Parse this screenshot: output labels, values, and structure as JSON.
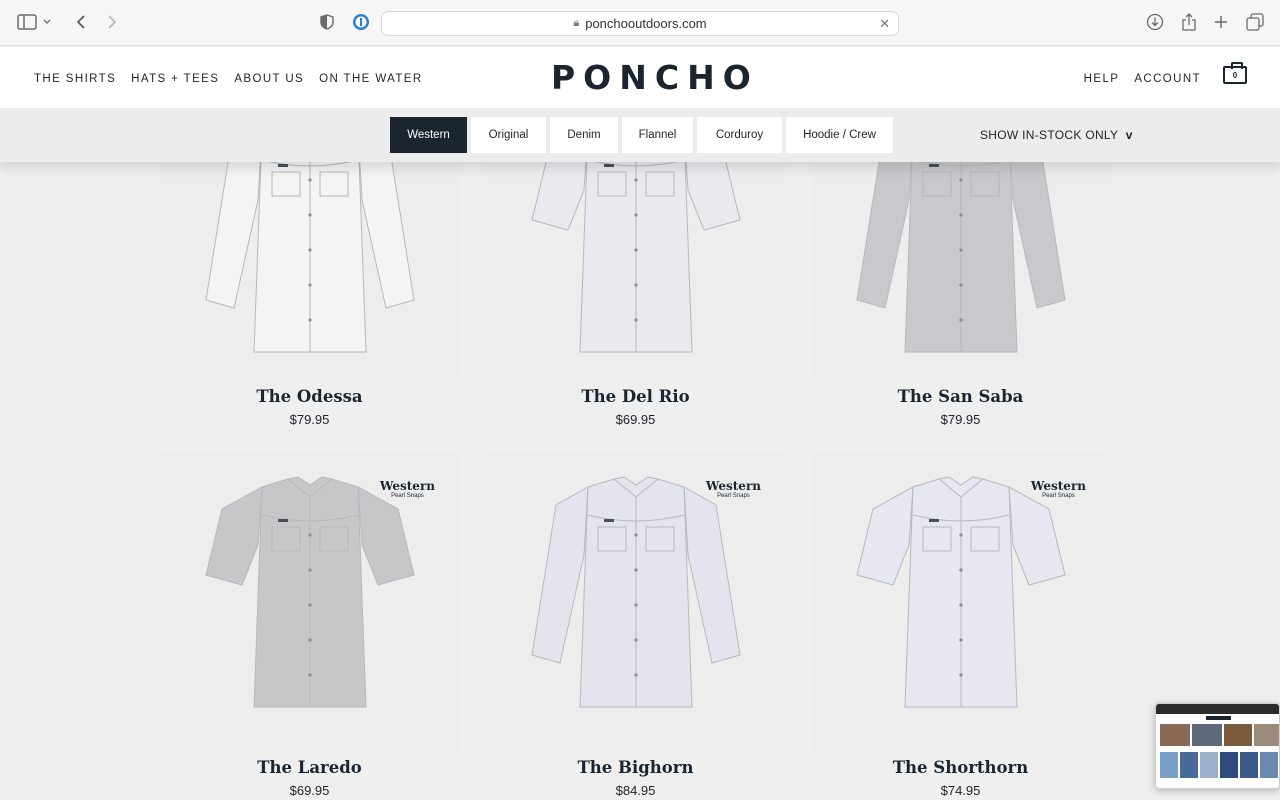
{
  "browser": {
    "url": "ponchooutdoors.com",
    "icons": [
      "sidebar-icon",
      "chevron-down-icon",
      "back-icon",
      "forward-icon",
      "shield-icon",
      "password-manager-icon",
      "clear-icon",
      "download-icon",
      "share-icon",
      "new-tab-icon",
      "tabs-overview-icon"
    ]
  },
  "header": {
    "logo": "PONCHO",
    "nav_left": [
      "THE SHIRTS",
      "HATS + TEES",
      "ABOUT US",
      "ON THE WATER"
    ],
    "nav_right": [
      "HELP",
      "ACCOUNT"
    ],
    "cart_count": "0"
  },
  "filters": {
    "tabs": [
      "Western",
      "Original",
      "Denim",
      "Flannel",
      "Corduroy",
      "Hoodie / Crew"
    ],
    "active_tab": "Western",
    "instock_label": "SHOW IN-STOCK ONLY",
    "instock_caret": "v"
  },
  "badge": {
    "title": "Western",
    "subtitle": "Pearl Snaps"
  },
  "products": [
    {
      "name": "The Odessa",
      "price": "$79.95",
      "color": "#f4f4f5",
      "sleeves": "long"
    },
    {
      "name": "The Del Rio",
      "price": "$69.95",
      "color": "#e9e9ef",
      "sleeves": "short"
    },
    {
      "name": "The San Saba",
      "price": "$79.95",
      "color": "#c9c8cc",
      "sleeves": "long"
    },
    {
      "name": "The Laredo",
      "price": "$69.95",
      "color": "#c7c7c9",
      "sleeves": "short"
    },
    {
      "name": "The Bighorn",
      "price": "$84.95",
      "color": "#e4e4ee",
      "sleeves": "long"
    },
    {
      "name": "The Shorthorn",
      "price": "$74.95",
      "color": "#e6e7f0",
      "sleeves": "short"
    }
  ]
}
